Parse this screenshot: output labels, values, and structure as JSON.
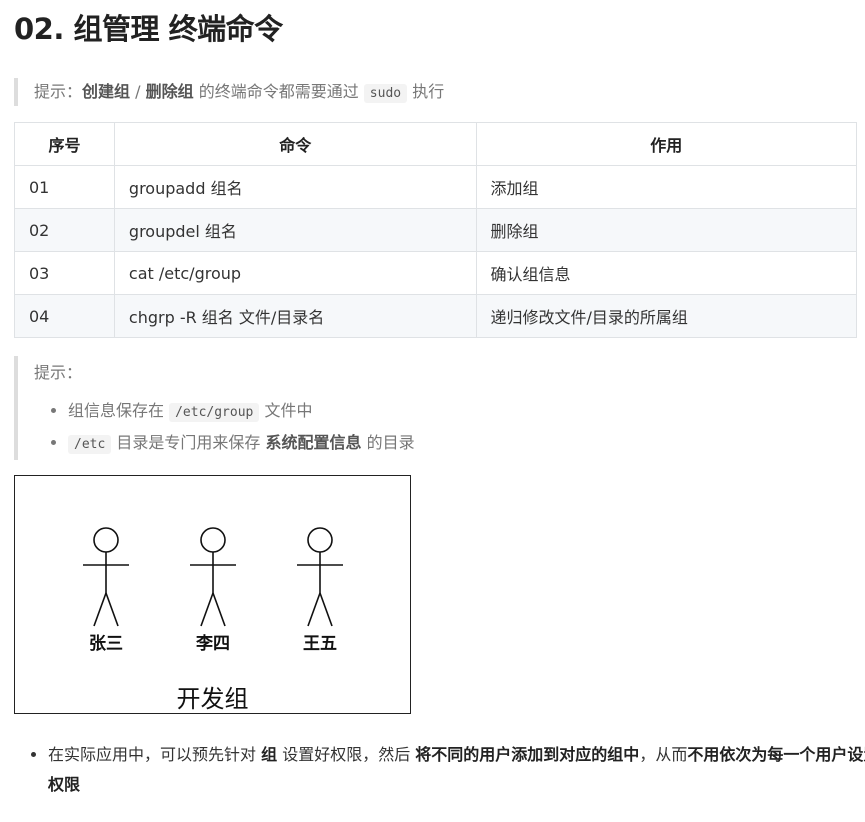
{
  "page": {
    "title": "02. 组管理 终端命令"
  },
  "tip1": {
    "prefix": "提示：",
    "bold1": "创建组",
    "sep": " / ",
    "bold2": "删除组",
    "mid": " 的终端命令都需要通过 ",
    "code": "sudo",
    "suffix": " 执行"
  },
  "table": {
    "headers": [
      "序号",
      "命令",
      "作用"
    ],
    "rows": [
      [
        "01",
        "groupadd 组名",
        "添加组"
      ],
      [
        "02",
        "groupdel 组名",
        "删除组"
      ],
      [
        "03",
        "cat /etc/group",
        "确认组信息"
      ],
      [
        "04",
        "chgrp -R 组名 文件/目录名",
        "递归修改文件/目录的所属组"
      ]
    ]
  },
  "tip2": {
    "label": "提示：",
    "item1": {
      "pre": "组信息保存在 ",
      "code": "/etc/group",
      "post": " 文件中"
    },
    "item2": {
      "code": "/etc",
      "pre": " 目录是专门用来保存 ",
      "bold": "系统配置信息",
      "post": " 的目录"
    }
  },
  "diagram": {
    "people": [
      "张三",
      "李四",
      "王五"
    ],
    "group": "开发组"
  },
  "bottom": {
    "t1": "在实际应用中，可以预先针对 ",
    "b1": "组",
    "t2": " 设置好权限，然后 ",
    "b2": "将不同的用户添加到对应的组中",
    "t3": "，从而",
    "b3": "不用依次为每一个用户设置权限"
  }
}
